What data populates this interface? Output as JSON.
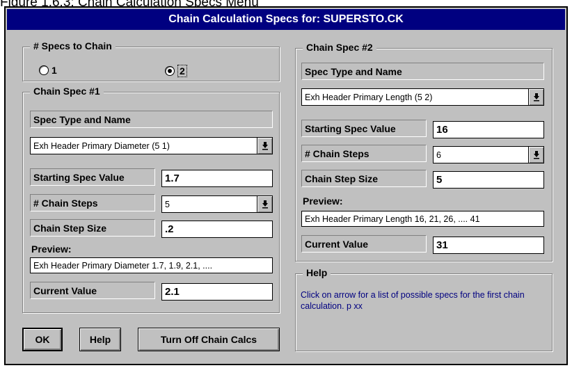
{
  "caption": "Figure 1.6.3: Chain Calculation Specs Menu",
  "window": {
    "title": "Chain Calculation Specs for: SUPERSTO.CK"
  },
  "specs_to_chain": {
    "label": "# Specs to Chain",
    "options": [
      {
        "label": "1",
        "selected": false
      },
      {
        "label": "2",
        "selected": true
      }
    ]
  },
  "chain_spec_1": {
    "label": "Chain Spec #1",
    "spec_type_label": "Spec Type and Name",
    "spec_type_value": "Exh Header Primary Diameter (5 1)",
    "starting_label": "Starting Spec Value",
    "starting_value": "1.7",
    "steps_label": "# Chain Steps",
    "steps_value": "5",
    "step_size_label": "Chain Step Size",
    "step_size_value": ".2",
    "preview_label": "Preview:",
    "preview_value": "Exh Header Primary Diameter  1.7, 1.9, 2.1, ....",
    "current_label": "Current Value",
    "current_value": "2.1"
  },
  "chain_spec_2": {
    "label": "Chain Spec #2",
    "spec_type_label": "Spec Type and Name",
    "spec_type_value": "Exh Header Primary Length (5 2)",
    "starting_label": "Starting Spec Value",
    "starting_value": "16",
    "steps_label": "# Chain Steps",
    "steps_value": "6",
    "step_size_label": "Chain Step Size",
    "step_size_value": "5",
    "preview_label": "Preview:",
    "preview_value": "Exh Header Primary Length  16, 21, 26, .... 41",
    "current_label": "Current Value",
    "current_value": "31"
  },
  "help": {
    "label": "Help",
    "text": "Click on arrow for a list of possible specs for the first chain calculation.  p xx"
  },
  "buttons": {
    "ok": "OK",
    "help": "Help",
    "turn_off": "Turn Off Chain Calcs"
  },
  "colors": {
    "title_bar": "#000080",
    "dialog_bg": "#c0c0c0",
    "help_text": "#000080"
  }
}
